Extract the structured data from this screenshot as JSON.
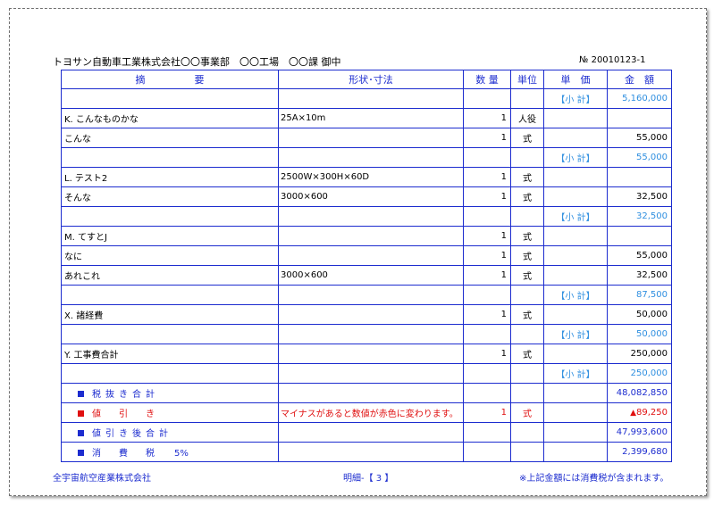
{
  "header": {
    "company": "トヨサン自動車工業株式会社〇〇事業部　〇〇工場　〇〇課 御中",
    "number": "№ 20010123-1"
  },
  "columns": {
    "desc": "摘　　　　　要",
    "spec": "形状･寸法",
    "qty": "数 量",
    "unit": "単位",
    "price": "単　価",
    "amount": "金　額"
  },
  "rows": [
    {
      "desc": "",
      "spec": "",
      "qty": "",
      "unit": "",
      "price": "【小 計】",
      "amount": "5,160,000"
    },
    {
      "desc": "K. こんなものかな",
      "spec": "25A×10m",
      "qty": "1",
      "unit": "人役",
      "price": "",
      "amount": ""
    },
    {
      "desc": "こんな",
      "spec": "",
      "qty": "1",
      "unit": "式",
      "price": "",
      "amount": "55,000"
    },
    {
      "desc": "",
      "spec": "",
      "qty": "",
      "unit": "",
      "price": "【小 計】",
      "amount": "55,000"
    },
    {
      "desc": "L. テスト2",
      "spec": "2500W×300H×60D",
      "qty": "1",
      "unit": "式",
      "price": "",
      "amount": ""
    },
    {
      "desc": "そんな",
      "spec": "3000×600",
      "qty": "1",
      "unit": "式",
      "price": "",
      "amount": "32,500"
    },
    {
      "desc": "",
      "spec": "",
      "qty": "",
      "unit": "",
      "price": "【小 計】",
      "amount": "32,500"
    },
    {
      "desc": "M. てすとJ",
      "spec": "",
      "qty": "1",
      "unit": "式",
      "price": "",
      "amount": ""
    },
    {
      "desc": "なに",
      "spec": "",
      "qty": "1",
      "unit": "式",
      "price": "",
      "amount": "55,000"
    },
    {
      "desc": "あれこれ",
      "spec": "3000×600",
      "qty": "1",
      "unit": "式",
      "price": "",
      "amount": "32,500"
    },
    {
      "desc": "",
      "spec": "",
      "qty": "",
      "unit": "",
      "price": "【小 計】",
      "amount": "87,500"
    },
    {
      "desc": "X. 諸経費",
      "spec": "",
      "qty": "1",
      "unit": "式",
      "price": "",
      "amount": "50,000"
    },
    {
      "desc": "",
      "spec": "",
      "qty": "",
      "unit": "",
      "price": "【小 計】",
      "amount": "50,000"
    },
    {
      "desc": "Y. 工事費合計",
      "spec": "",
      "qty": "1",
      "unit": "式",
      "price": "",
      "amount": "250,000"
    },
    {
      "desc": "",
      "spec": "",
      "qty": "",
      "unit": "",
      "price": "【小 計】",
      "amount": "250,000"
    }
  ],
  "summary": {
    "pretax_label": "税抜き合計",
    "pretax_amount": "48,082,850",
    "discount_label": "値　　引　　き",
    "discount_note": "マイナスがあると数値が赤色に変わります。",
    "discount_qty": "1",
    "discount_unit": "式",
    "discount_triangle": "▲",
    "discount_amount": "89,250",
    "after_discount_label": "値引き後合計",
    "after_discount_amount": "47,993,600",
    "tax_label": "消　　費　　税",
    "tax_rate": "5%",
    "tax_amount": "2,399,680"
  },
  "footer": {
    "company": "全宇宙航空産業株式会社",
    "page": "明細-【 3 】",
    "note": "※上記金額には消費税が含まれます。"
  },
  "colors": {
    "line_blue": "#1c2ccf",
    "subtotal_blue": "#2f8fe0",
    "negative_red": "#e01010"
  }
}
